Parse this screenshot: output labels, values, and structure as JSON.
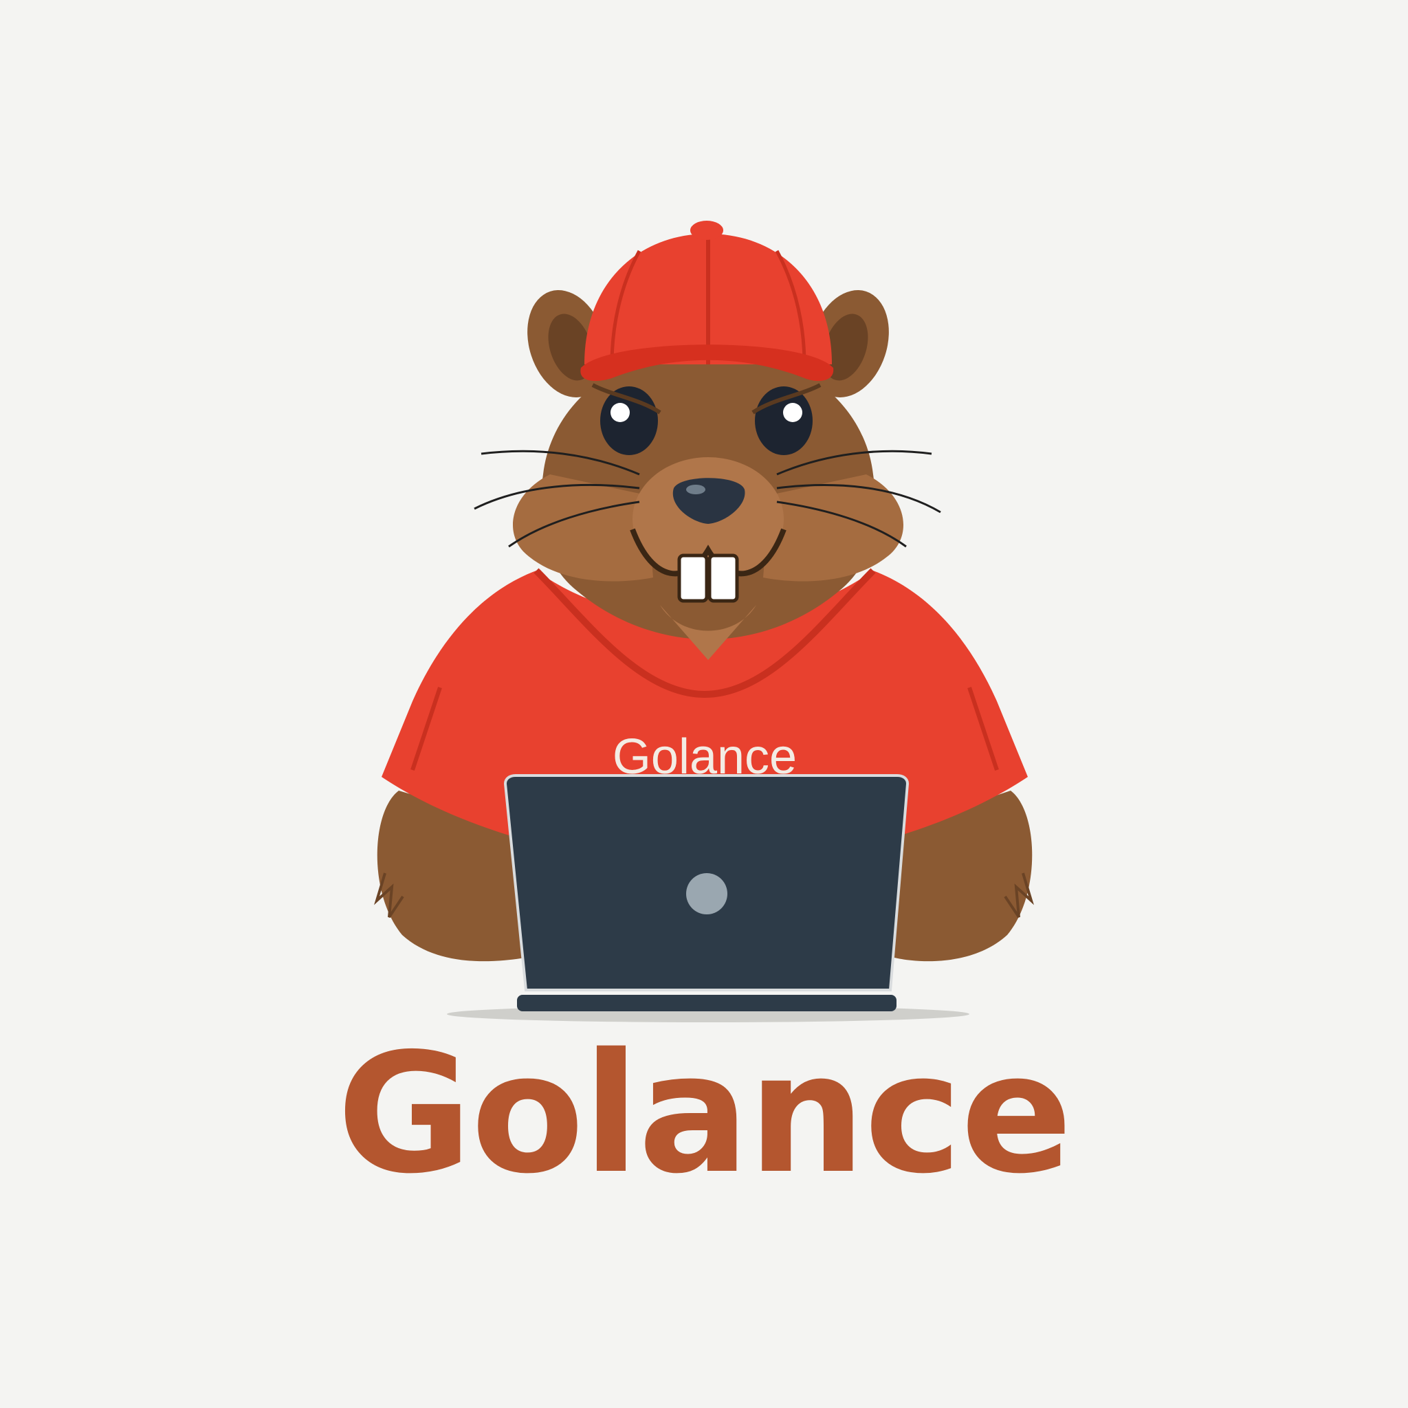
{
  "brand": {
    "shirt_text": "Golance",
    "wordmark": "Golance"
  },
  "colors": {
    "background": "#f4f4f2",
    "fur": "#8b5a33",
    "fur_light": "#b0764a",
    "fur_dark": "#5a3a20",
    "cap": "#e8412f",
    "shirt": "#e8412f",
    "laptop": "#2d3b48",
    "laptop_logo": "#9aa7b0",
    "wordmark": "#b4562f"
  },
  "icons": {
    "mascot": "gopher-mascot-icon",
    "laptop": "laptop-icon"
  }
}
